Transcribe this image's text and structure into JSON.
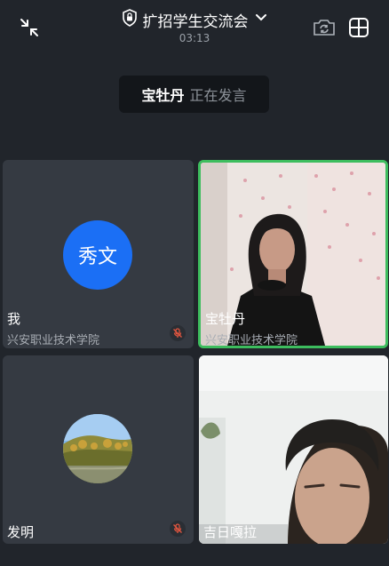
{
  "header": {
    "title": "扩招学生交流会",
    "timer": "03:13",
    "icons": [
      "minimize-icon",
      "lock-icon",
      "chevron-down-icon",
      "camera-switch-icon",
      "grid-layout-icon"
    ]
  },
  "active_speaker": {
    "name": "宝牡丹",
    "status": "正在发言"
  },
  "participants": [
    {
      "name": "我",
      "org": "兴安职业技术学院",
      "avatar_text": "秀文",
      "avatar_color": "#1b6ff5",
      "muted": true
    },
    {
      "name": "宝牡丹",
      "org": "兴安职业技术学院",
      "video": true,
      "speaking": true,
      "highlight_color": "#3dbd5e"
    },
    {
      "name": "发明",
      "avatar": "landscape-photo",
      "muted": true
    },
    {
      "name": "吉日嘎拉",
      "video": true
    }
  ]
}
